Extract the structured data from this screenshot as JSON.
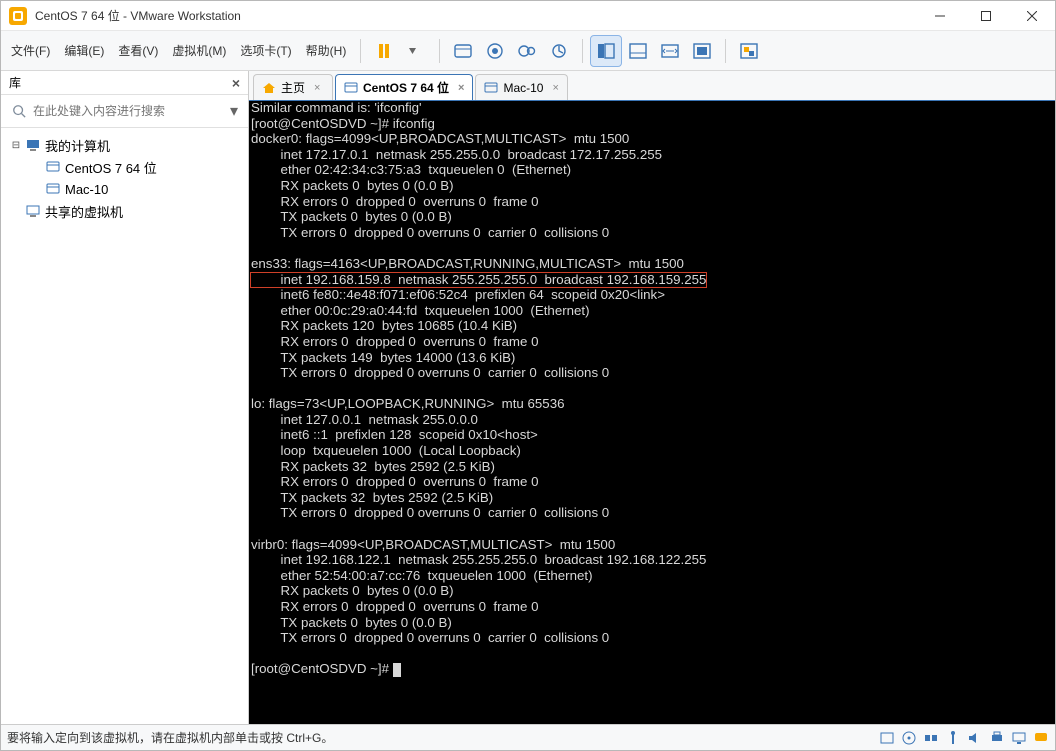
{
  "window": {
    "title": "CentOS 7 64 位 - VMware Workstation"
  },
  "menu": {
    "file": "文件(F)",
    "edit": "编辑(E)",
    "view": "查看(V)",
    "vm": "虚拟机(M)",
    "tabs": "选项卡(T)",
    "help": "帮助(H)"
  },
  "sidebar": {
    "title": "库",
    "search_placeholder": "在此处键入内容进行搜索",
    "tree": {
      "root1": "我的计算机",
      "vm1": "CentOS 7 64 位",
      "vm2": "Mac-10",
      "root2": "共享的虚拟机"
    }
  },
  "tabs": {
    "home": "主页",
    "t1": "CentOS 7 64 位",
    "t2": "Mac-10"
  },
  "terminal": {
    "lines_pre": "Similar command is: 'ifconfig'\n[root@CentOSDVD ~]# ifconfig\ndocker0: flags=4099<UP,BROADCAST,MULTICAST>  mtu 1500\n        inet 172.17.0.1  netmask 255.255.0.0  broadcast 172.17.255.255\n        ether 02:42:34:c3:75:a3  txqueuelen 0  (Ethernet)\n        RX packets 0  bytes 0 (0.0 B)\n        RX errors 0  dropped 0  overruns 0  frame 0\n        TX packets 0  bytes 0 (0.0 B)\n        TX errors 0  dropped 0 overruns 0  carrier 0  collisions 0\n\nens33: flags=4163<UP,BROADCAST,RUNNING,MULTICAST>  mtu 1500",
    "highlight": "        inet 192.168.159.8  netmask 255.255.255.0  broadcast 192.168.159.255",
    "lines_post": "        inet6 fe80::4e48:f071:ef06:52c4  prefixlen 64  scopeid 0x20<link>\n        ether 00:0c:29:a0:44:fd  txqueuelen 1000  (Ethernet)\n        RX packets 120  bytes 10685 (10.4 KiB)\n        RX errors 0  dropped 0  overruns 0  frame 0\n        TX packets 149  bytes 14000 (13.6 KiB)\n        TX errors 0  dropped 0 overruns 0  carrier 0  collisions 0\n\nlo: flags=73<UP,LOOPBACK,RUNNING>  mtu 65536\n        inet 127.0.0.1  netmask 255.0.0.0\n        inet6 ::1  prefixlen 128  scopeid 0x10<host>\n        loop  txqueuelen 1000  (Local Loopback)\n        RX packets 32  bytes 2592 (2.5 KiB)\n        RX errors 0  dropped 0  overruns 0  frame 0\n        TX packets 32  bytes 2592 (2.5 KiB)\n        TX errors 0  dropped 0 overruns 0  carrier 0  collisions 0\n\nvirbr0: flags=4099<UP,BROADCAST,MULTICAST>  mtu 1500\n        inet 192.168.122.1  netmask 255.255.255.0  broadcast 192.168.122.255\n        ether 52:54:00:a7:cc:76  txqueuelen 1000  (Ethernet)\n        RX packets 0  bytes 0 (0.0 B)\n        RX errors 0  dropped 0  overruns 0  frame 0\n        TX packets 0  bytes 0 (0.0 B)\n        TX errors 0  dropped 0 overruns 0  carrier 0  collisions 0\n\n[root@CentOSDVD ~]# "
  },
  "status": {
    "text": "要将输入定向到该虚拟机，请在虚拟机内部单击或按 Ctrl+G。"
  }
}
